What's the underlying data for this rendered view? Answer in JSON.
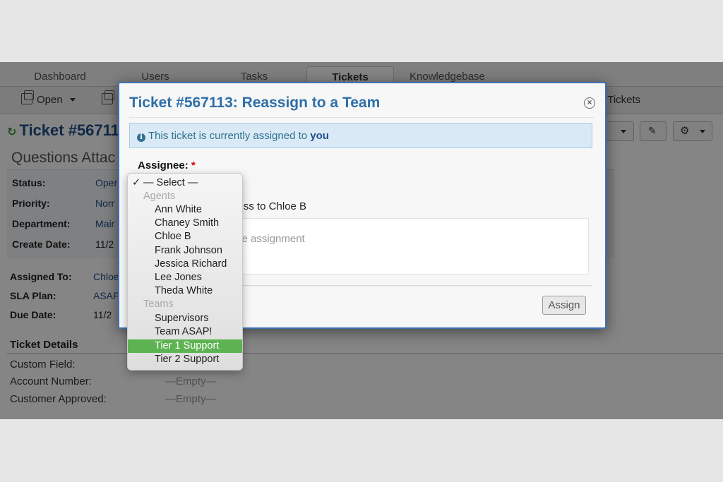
{
  "nav": {
    "tabs": [
      {
        "label": "Dashboard",
        "active": false
      },
      {
        "label": "Users",
        "active": false
      },
      {
        "label": "Tasks",
        "active": false
      },
      {
        "label": "Tickets",
        "active": true
      },
      {
        "label": "Knowledgebase",
        "active": false
      }
    ],
    "subnav": {
      "open_label": "Open",
      "closed_tickets_label": "d Tickets"
    }
  },
  "ticket": {
    "title": "Ticket #56711",
    "subject": "Questions Attac",
    "fields": [
      {
        "label": "Status:",
        "value": "Oper"
      },
      {
        "label": "Priority:",
        "value": "Norr"
      },
      {
        "label": "Department:",
        "value": "Mair"
      },
      {
        "label": "Create Date:",
        "value": "11/2"
      }
    ],
    "assignment_fields": [
      {
        "label": "Assigned To:",
        "value": "Chloe"
      },
      {
        "label": "SLA Plan:",
        "value": "ASAF"
      },
      {
        "label": "Due Date:",
        "value": "11/2"
      }
    ],
    "details_header": "Ticket Details",
    "details": [
      {
        "label": "Custom Field:",
        "value": ""
      },
      {
        "label": "Account Number:",
        "value": "—Empty—"
      },
      {
        "label": "Customer Approved:",
        "value": "—Empty—"
      }
    ]
  },
  "modal": {
    "title": "Ticket #567113: Reassign to a Team",
    "alert_prefix": "This ticket is currently assigned to",
    "alert_bold": "you",
    "assignee_label": "Assignee:",
    "required_mark": "*",
    "access_text": "cess to Chloe B",
    "comment_placeholder_visible": "the assignment",
    "assign_button": "Assign"
  },
  "dropdown": {
    "selected": "— Select —",
    "check": "✓",
    "groups": [
      {
        "label": "Agents",
        "options": [
          "Ann White",
          "Chaney Smith",
          "Chloe B",
          "Frank Johnson",
          "Jessica Richard",
          "Lee Jones",
          "Theda White"
        ]
      },
      {
        "label": "Teams",
        "options": [
          "Supervisors",
          "Team ASAP!",
          "Tier 1 Support",
          "Tier 2 Support"
        ]
      }
    ],
    "highlighted": "Tier 1 Support",
    "highlight_color": "#5db352"
  }
}
